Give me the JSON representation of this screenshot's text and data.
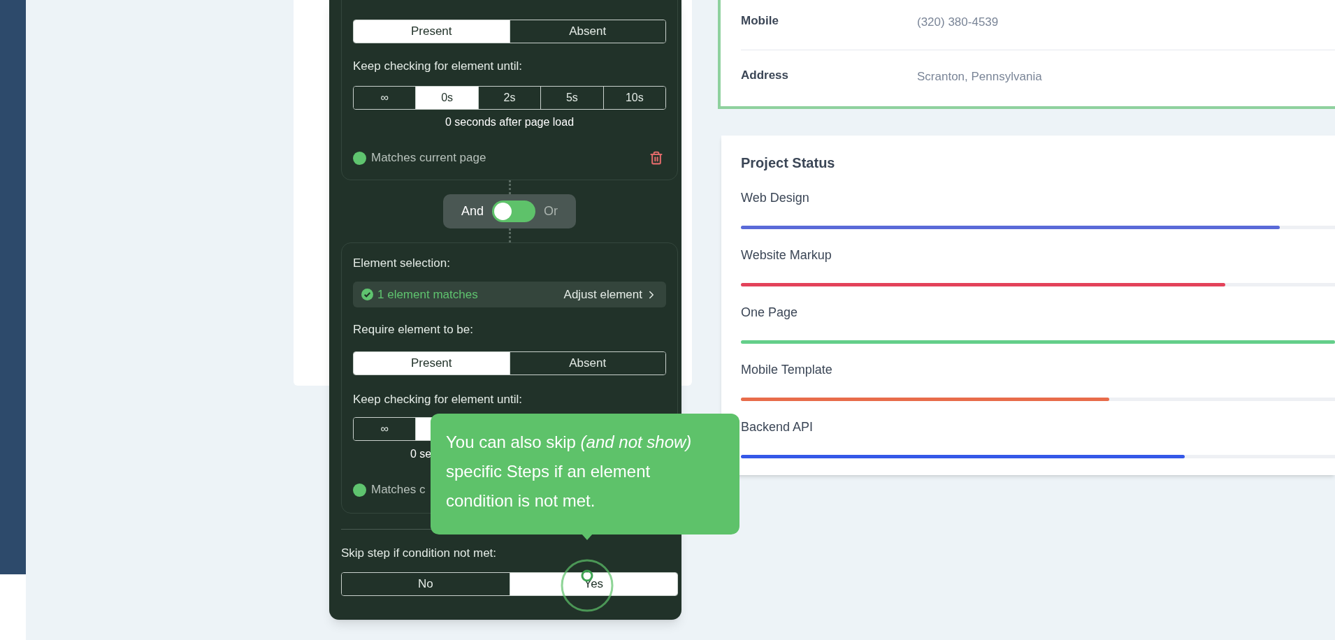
{
  "condition_panel": {
    "conditions": [
      {
        "presence_options": [
          {
            "label": "Present",
            "selected": true
          },
          {
            "label": "Absent",
            "selected": false
          }
        ],
        "wait_label": "Keep checking for element until:",
        "wait_options": [
          {
            "label": "∞",
            "selected": false
          },
          {
            "label": "0s",
            "selected": true
          },
          {
            "label": "2s",
            "selected": false
          },
          {
            "label": "5s",
            "selected": false
          },
          {
            "label": "10s",
            "selected": false
          }
        ],
        "wait_caption": "0 seconds after page load",
        "match_text": "Matches current page",
        "matches": true
      },
      {
        "element_selection": {
          "label": "Element selection:",
          "match_text": "1 element matches",
          "action": "Adjust element"
        },
        "require_label": "Require element to be:",
        "presence_options": [
          {
            "label": "Present",
            "selected": true
          },
          {
            "label": "Absent",
            "selected": false
          }
        ],
        "wait_label": "Keep checking for element until:",
        "wait_options": [
          {
            "label": "∞",
            "selected": false
          },
          {
            "selected": true
          }
        ],
        "wait_caption": "0 se",
        "match_text": "Matches c",
        "matches": true
      }
    ],
    "logic": [
      {
        "label": "And",
        "selected": true
      },
      {
        "label": "Or",
        "selected": false
      }
    ],
    "skip": {
      "label": "Skip step if condition not met:",
      "options": [
        {
          "label": "No",
          "selected": false
        },
        {
          "label": "Yes",
          "selected": true
        }
      ]
    }
  },
  "tooltip": {
    "text": "You can also skip *(and not show)* specific Steps if an element condition is not met."
  },
  "contact": [
    {
      "label": "Mobile",
      "value": "(320) 380-4539"
    },
    {
      "label": "Address",
      "value": "Scranton, Pennsylvania"
    }
  ],
  "project_status": {
    "title": "Project Status",
    "items": [
      {
        "label": "Web Design",
        "level": 0.907,
        "color": "#5a6ad8"
      },
      {
        "label": "Website Markup",
        "level": 0.815,
        "color": "#e3425a"
      },
      {
        "label": "One Page",
        "level": 1.0,
        "color": "#64cf8a"
      },
      {
        "label": "Mobile Template",
        "level": 0.62,
        "color": "#e86c4a"
      },
      {
        "label": "Backend API",
        "level": 0.747,
        "color": "#3558e8"
      }
    ]
  }
}
